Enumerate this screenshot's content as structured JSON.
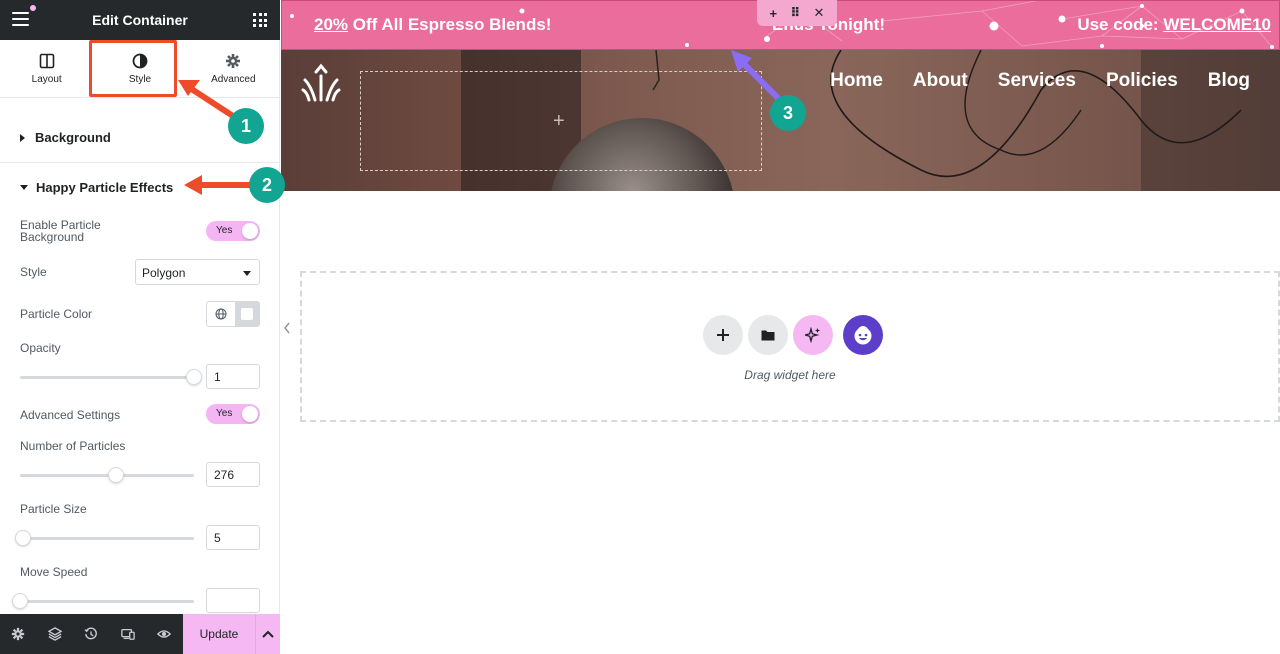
{
  "panel": {
    "title": "Edit Container",
    "tabs": [
      {
        "label": "Layout",
        "icon": "layout-icon"
      },
      {
        "label": "Style",
        "icon": "half-circle-icon"
      },
      {
        "label": "Advanced",
        "icon": "gear-icon"
      }
    ],
    "sections": {
      "background": "Background",
      "particles": "Happy Particle Effects"
    },
    "controls": {
      "enable_label": "Enable Particle Background",
      "enable_value": "Yes",
      "style_label": "Style",
      "style_value": "Polygon",
      "color_label": "Particle Color",
      "opacity_label": "Opacity",
      "opacity_value": "1",
      "advanced_label": "Advanced Settings",
      "advanced_value": "Yes",
      "count_label": "Number of Particles",
      "count_value": "276",
      "size_label": "Particle Size",
      "size_value": "5",
      "speed_label": "Move Speed",
      "speed_value": ""
    },
    "footer": {
      "update_label": "Update",
      "icons": [
        "gear-icon",
        "layers-icon",
        "history-icon",
        "responsive-icon",
        "eye-icon"
      ]
    }
  },
  "canvas": {
    "promo": {
      "left_underlined": "20%",
      "left_rest": " Off All Espresso Blends!",
      "middle": "Ends Tonight!",
      "right_prefix": "Use code: ",
      "right_code": "WELCOME10"
    },
    "nav": [
      "Home",
      "About",
      "Services",
      "Policies",
      "Blog"
    ],
    "drop_text": "Drag widget here"
  },
  "annotations": [
    "1",
    "2",
    "3"
  ],
  "colors": {
    "accent_pink": "#f5b8f3",
    "promo_bar": "#ea6d9b",
    "annotation_red": "#ee4b2b",
    "annotation_teal": "#12a592",
    "annotation_purple": "#8a6cf5",
    "happy_addons": "#5c3ec9"
  }
}
